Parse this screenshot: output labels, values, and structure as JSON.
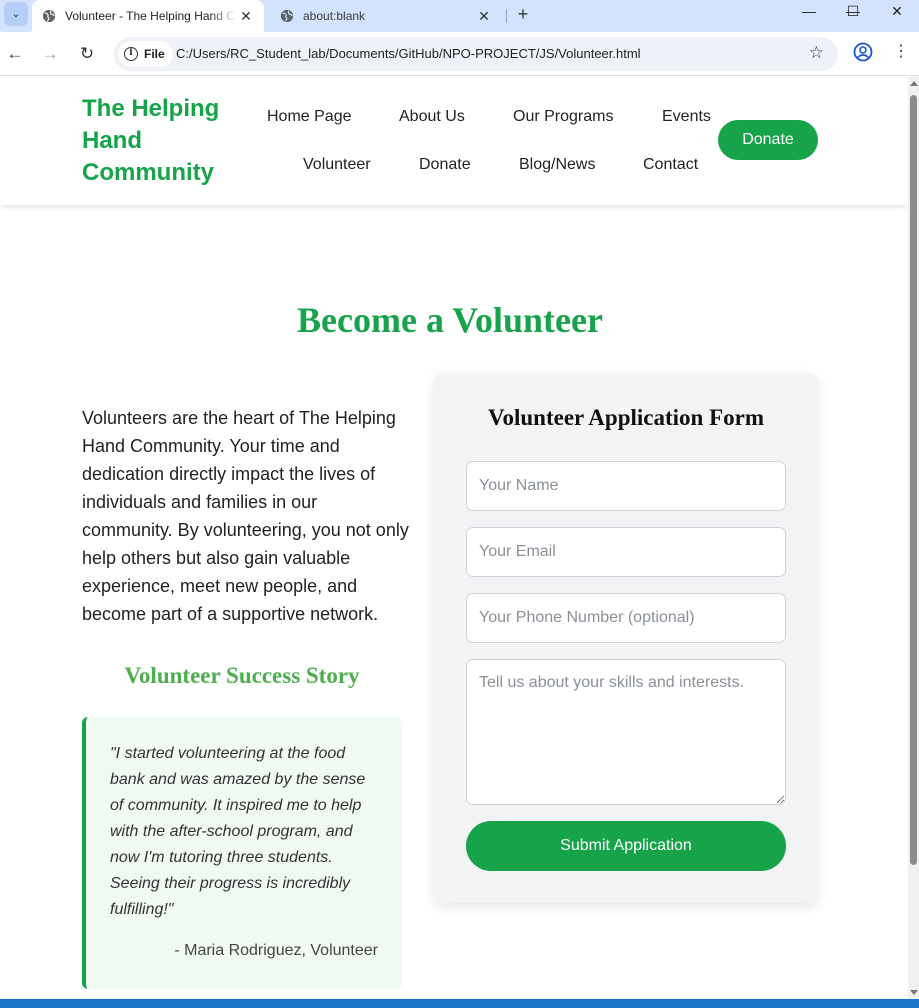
{
  "browser": {
    "tabs": [
      {
        "title": "Volunteer - The Helping Hand Community",
        "close": "✕"
      },
      {
        "title": "about:blank",
        "close": "✕"
      }
    ],
    "new_tab": "+",
    "window_controls": {
      "minimize": "—",
      "maximize": "☐",
      "close": "✕"
    },
    "nav": {
      "back": "←",
      "forward": "→",
      "reload": "↻"
    },
    "address": {
      "chip_label": "File",
      "info_glyph": "i",
      "url": "C:/Users/RC_Student_lab/Documents/GitHub/NPO-PROJECT/JS/Volunteer.html"
    },
    "icons": {
      "star": "☆",
      "menu": "⋮",
      "tab_menu": "⌄"
    }
  },
  "header": {
    "logo": "The Helping Hand Community",
    "nav": [
      "Home Page",
      "About Us",
      "Our Programs",
      "Events",
      "Volunteer",
      "Donate",
      "Blog/News",
      "Contact"
    ],
    "donate_button": "Donate"
  },
  "main": {
    "heading": "Become a Volunteer",
    "intro": "Volunteers are the heart of The Helping Hand Community. Your time and dedication directly impact the lives of individuals and families in our community. By volunteering, you not only help others but also gain valuable experience, meet new people, and become part of a supportive network.",
    "story": {
      "heading": "Volunteer Success Story",
      "quote": "\"I started volunteering at the food bank and was amazed by the sense of community. It inspired me to help with the after-school program, and now I'm tutoring three students. Seeing their progress is incredibly fulfilling!\"",
      "author": "- Maria Rodriguez, Volunteer"
    },
    "form": {
      "title": "Volunteer Application Form",
      "name_placeholder": "Your Name",
      "email_placeholder": "Your Email",
      "phone_placeholder": "Your Phone Number (optional)",
      "skills_placeholder": "Tell us about your skills and interests.",
      "submit": "Submit Application"
    }
  },
  "colors": {
    "brand_green": "#16a34a",
    "story_green": "#4cae4c",
    "tabbar_blue": "#d3e3fd"
  }
}
